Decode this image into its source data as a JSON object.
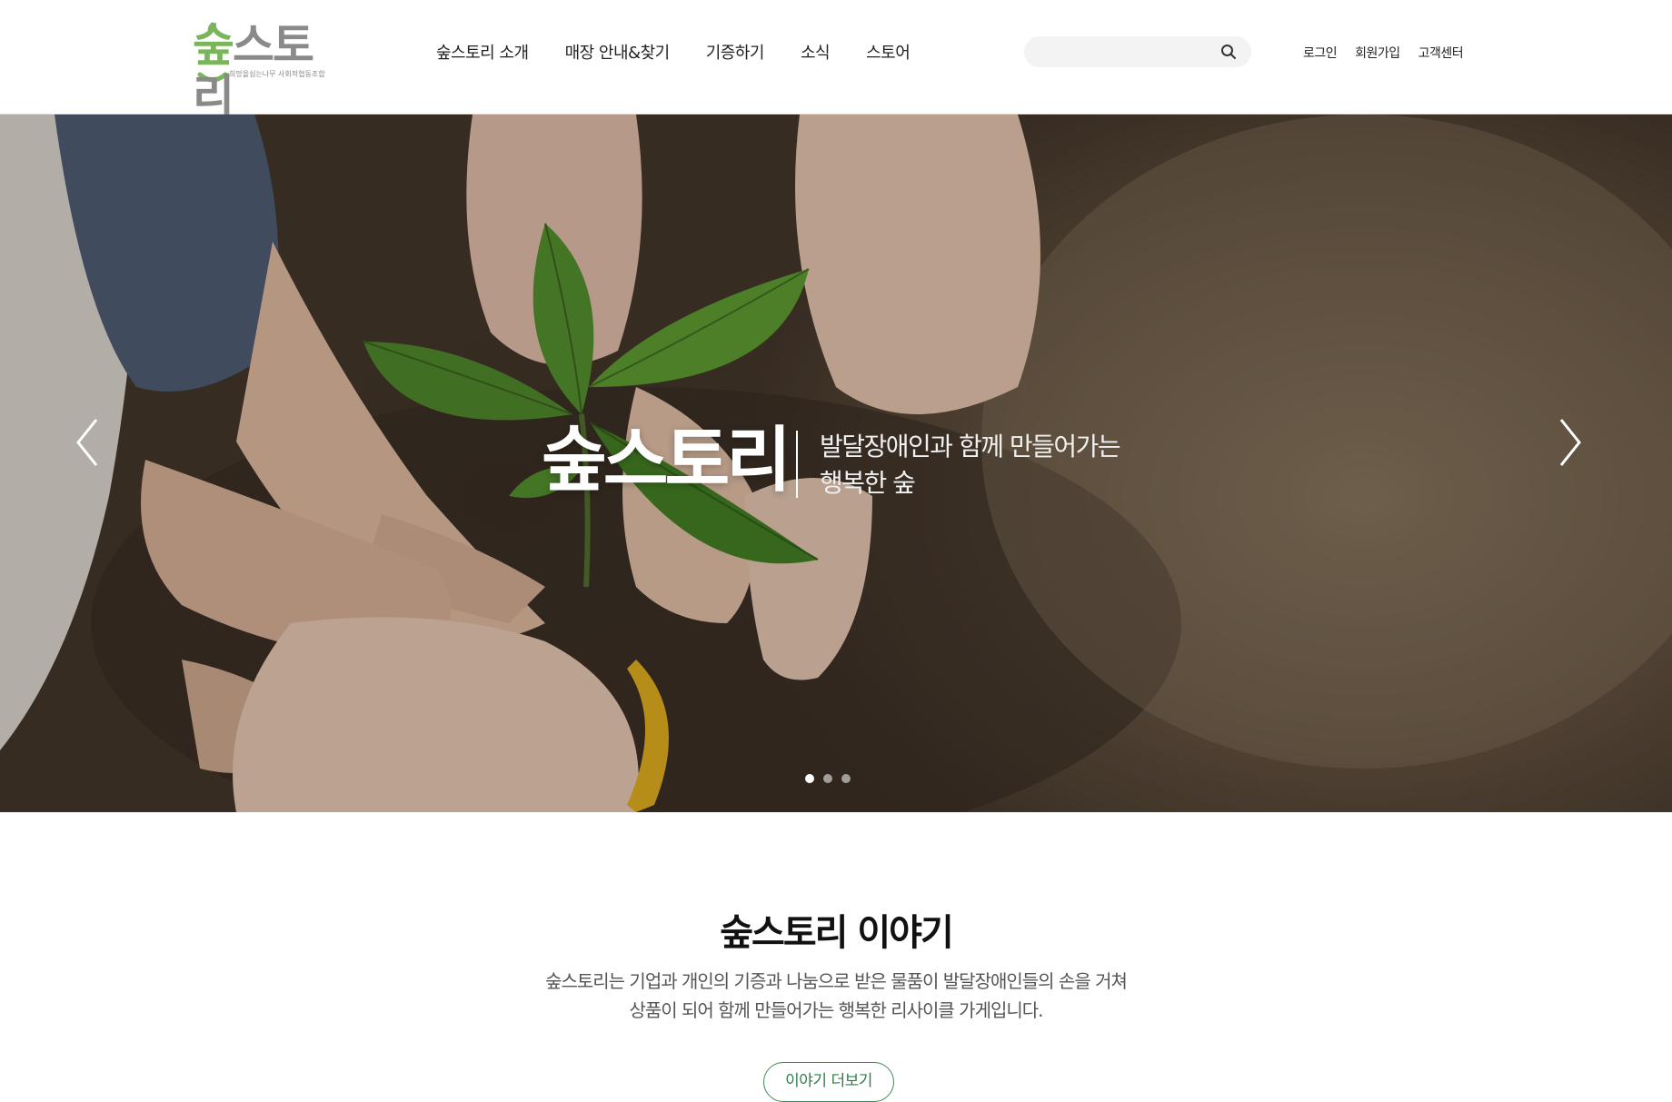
{
  "header": {
    "logo": {
      "text": "숲스토리",
      "subtitle": "희망을심는나무 사회적협동조합"
    },
    "nav": [
      {
        "label": "숲스토리 소개"
      },
      {
        "label": "매장 안내&찾기"
      },
      {
        "label": "기증하기"
      },
      {
        "label": "소식"
      },
      {
        "label": "스토어"
      }
    ],
    "search": {
      "placeholder": ""
    },
    "util": [
      {
        "label": "로그인"
      },
      {
        "label": "회원가입"
      },
      {
        "label": "고객센터"
      }
    ]
  },
  "hero": {
    "title": "숲스토리",
    "subtitle_line1": "발달장애인과 함께 만들어가는",
    "subtitle_line2": "행복한 숲",
    "slides_total": 3,
    "active_slide": 1
  },
  "story": {
    "title": "숲스토리 이야기",
    "desc_line1": "숲스토리는 기업과 개인의 기증과 나눔으로 받은 물품이 발달장애인들의 손을 거쳐",
    "desc_line2": "상품이 되어 함께 만들어가는 행복한 리사이클 가게입니다.",
    "more_label": "이야기 더보기"
  },
  "colors": {
    "brand_green": "#7ab55c",
    "button_green": "#3d8b54",
    "logo_gray": "#8a8a8a"
  }
}
